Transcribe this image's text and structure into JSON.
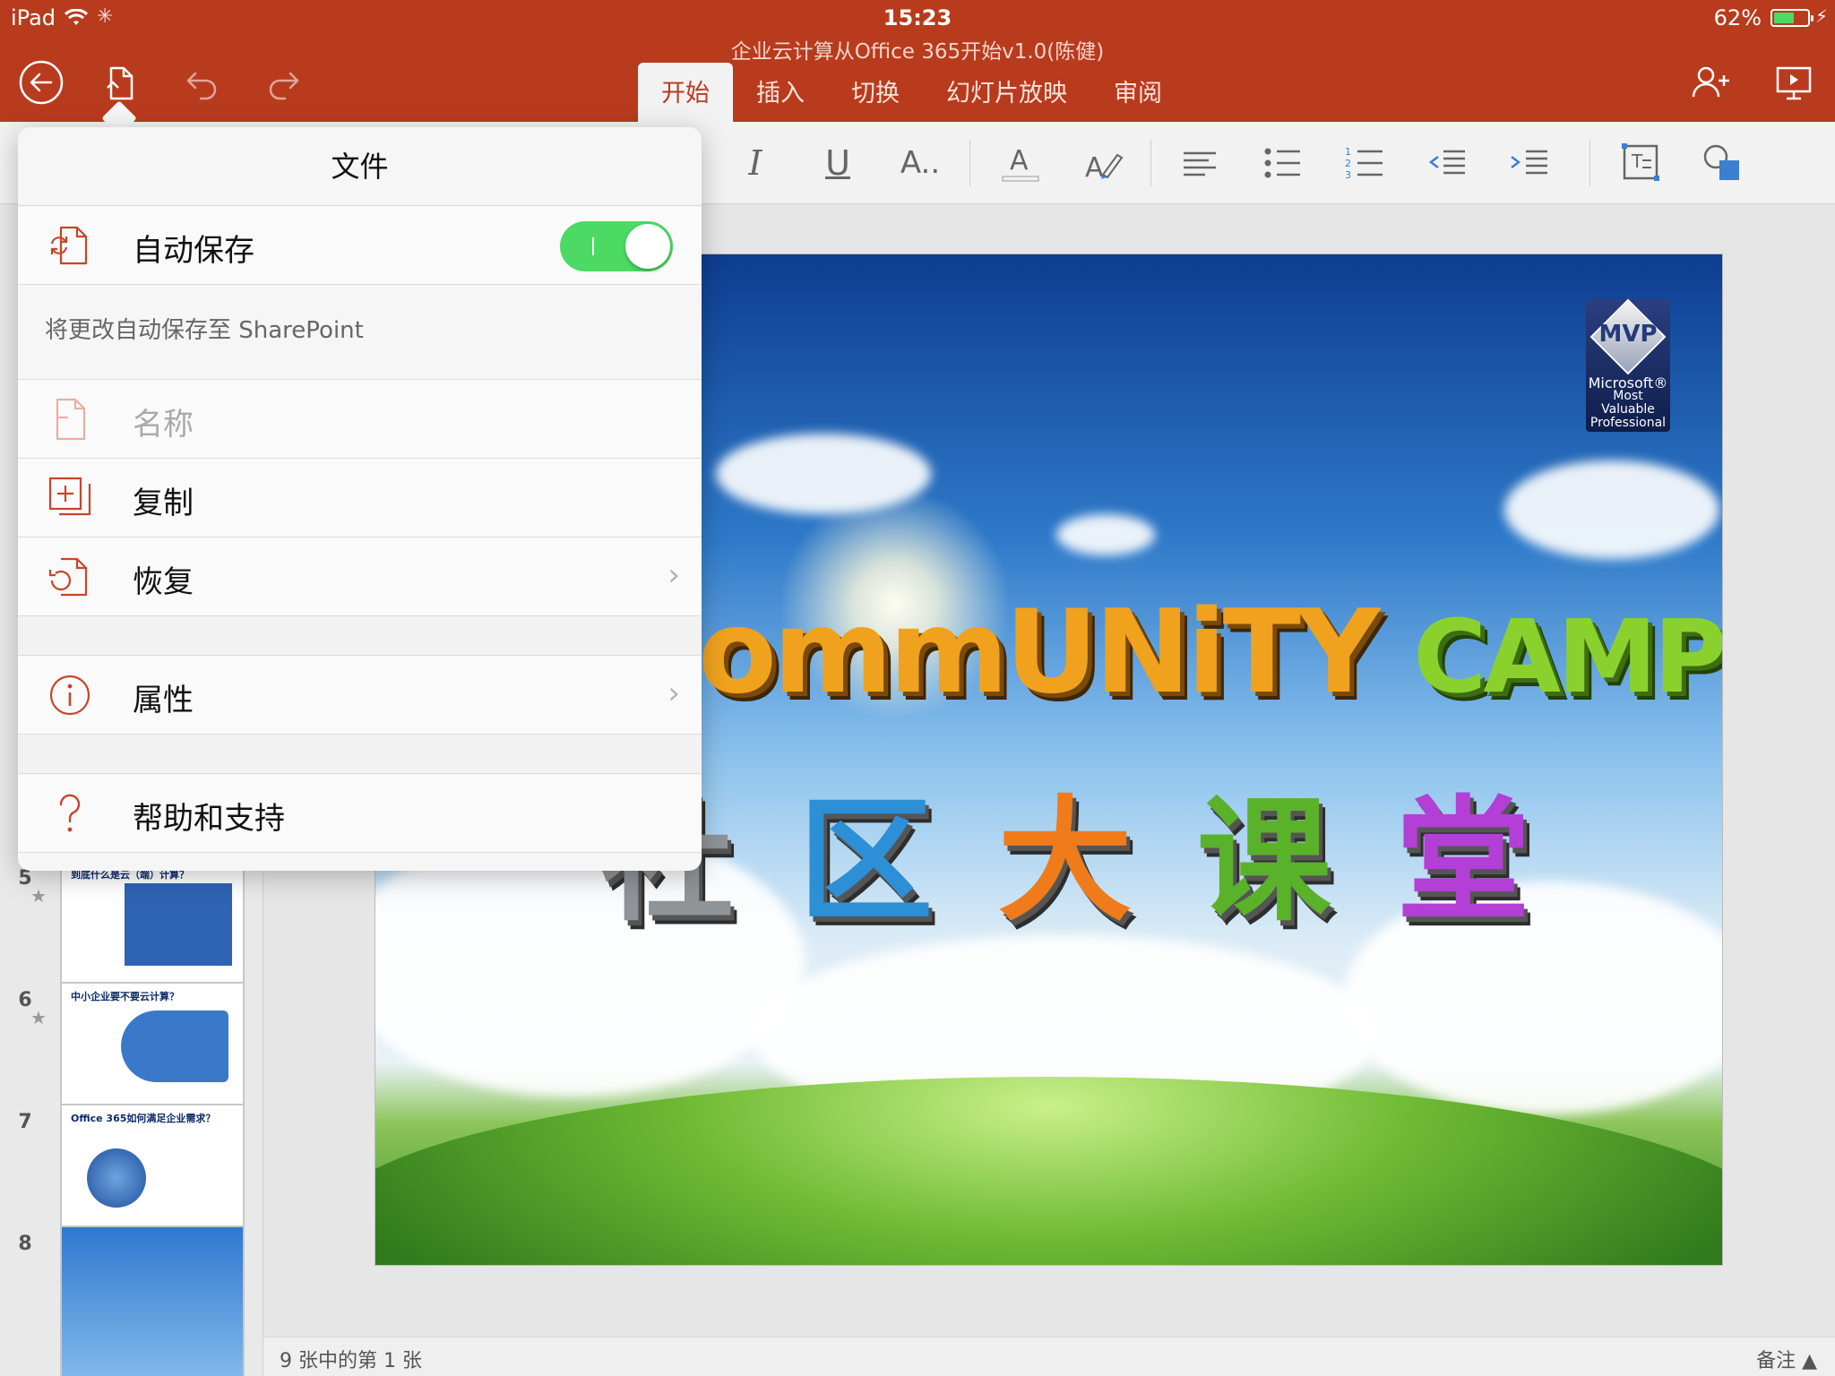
{
  "status_bar": {
    "device": "iPad",
    "time": "15:23",
    "battery_text": "62%",
    "battery_level": 0.62
  },
  "document": {
    "title": "企业云计算从Office 365开始v1.0(陈健)"
  },
  "ribbon": {
    "tabs": [
      {
        "label": "开始",
        "active": true
      },
      {
        "label": "插入",
        "active": false
      },
      {
        "label": "切换",
        "active": false
      },
      {
        "label": "幻灯片放映",
        "active": false
      },
      {
        "label": "审阅",
        "active": false
      }
    ],
    "tools": [
      "bold",
      "italic",
      "underline",
      "font-size",
      "font-color",
      "highlight",
      "align-left",
      "bullets",
      "numbering",
      "decrease-indent",
      "increase-indent",
      "text-box",
      "shapes"
    ]
  },
  "file_menu": {
    "title": "文件",
    "autosave": {
      "label": "自动保存",
      "on": true,
      "note": "将更改自动保存至 SharePoint"
    },
    "items": [
      {
        "label": "名称",
        "icon": "document-icon",
        "enabled": false,
        "chevron": false
      },
      {
        "label": "复制",
        "icon": "duplicate-icon",
        "enabled": true,
        "chevron": false
      },
      {
        "label": "恢复",
        "icon": "restore-icon",
        "enabled": true,
        "chevron": true
      }
    ],
    "properties": {
      "label": "属性",
      "icon": "info-icon",
      "chevron": true
    },
    "help": {
      "label": "帮助和支持",
      "icon": "help-icon"
    }
  },
  "slide_thumbnails": [
    {
      "number": "5",
      "title": "到底什么是云（端）计算？",
      "starred": true
    },
    {
      "number": "6",
      "title": "中小企业要不要云计算？",
      "starred": true
    },
    {
      "number": "7",
      "title": "Office 365如何满足企业需求？",
      "starred": false
    },
    {
      "number": "8",
      "title": "",
      "starred": false
    }
  ],
  "slide": {
    "headline": "CommUNiTY",
    "headline_accent": "CAMP",
    "chinese_title": [
      "社",
      "区",
      "大",
      "课",
      "堂"
    ],
    "badge": {
      "mark": "MVP",
      "line1": "Microsoft®",
      "line2": "Most Valuable",
      "line3": "Professional"
    }
  },
  "bottom_bar": {
    "slide_count": "9 张中的第 1 张",
    "notes": "备注 ▲"
  },
  "colors": {
    "accent": "#b83b1e",
    "toggle_on": "#4cd964"
  }
}
